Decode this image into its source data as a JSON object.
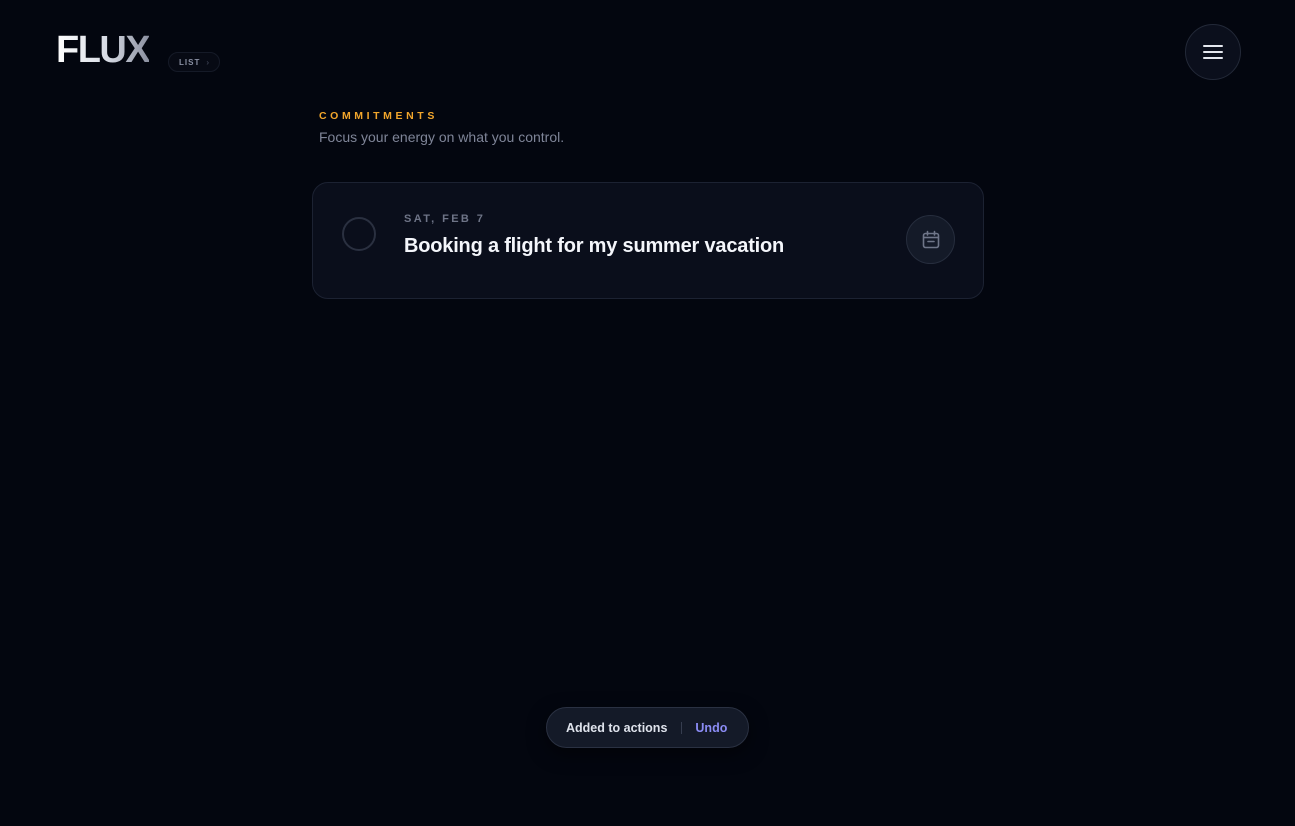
{
  "header": {
    "logo": "FLUX",
    "view_toggle": {
      "label": "LIST",
      "chevron_icon": "chevron-right-icon"
    },
    "menu_icon": "hamburger-menu-icon"
  },
  "section": {
    "label": "COMMITMENTS",
    "subtitle": "Focus your energy on what you control."
  },
  "commitments": [
    {
      "date": "SAT, FEB 7",
      "title": "Booking a flight for my summer vacation",
      "completed": false,
      "action_icon": "calendar-icon"
    }
  ],
  "toast": {
    "message": "Added to actions",
    "action_label": "Undo"
  },
  "colors": {
    "background": "#03060f",
    "accent_orange": "#f2a62c",
    "undo_purple": "#8b8cf5"
  }
}
